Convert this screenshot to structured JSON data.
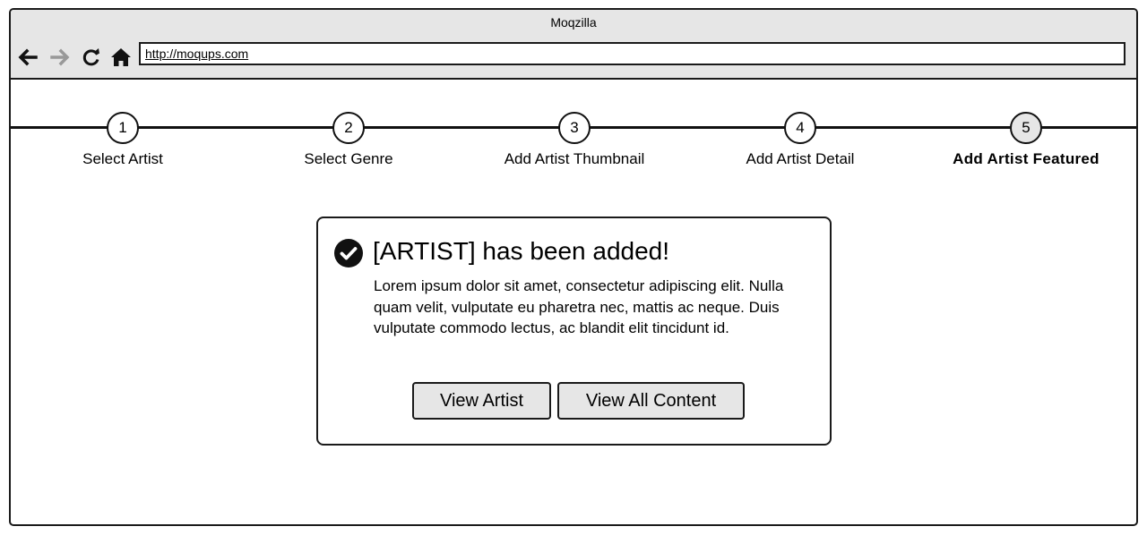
{
  "browser": {
    "title": "Moqzilla",
    "url": "http://moqups.com",
    "nav_icons": [
      "back-arrow-icon",
      "forward-arrow-icon",
      "refresh-icon",
      "home-icon"
    ]
  },
  "stepper": {
    "steps": [
      {
        "number": "1",
        "label": "Select Artist"
      },
      {
        "number": "2",
        "label": "Select Genre"
      },
      {
        "number": "3",
        "label": "Add Artist Thumbnail"
      },
      {
        "number": "4",
        "label": "Add Artist Detail"
      },
      {
        "number": "5",
        "label": "Add Artist Featured"
      }
    ],
    "active_step": 5
  },
  "dialog": {
    "icon": "check-circle-icon",
    "title": "[ARTIST] has been added!",
    "body": "Lorem ipsum dolor sit amet, consectetur adipiscing elit. Nulla quam velit, vulputate eu pharetra nec, mattis ac neque. Duis vulputate commodo lectus, ac blandit elit tincidunt id.",
    "buttons": {
      "view_artist": "View Artist",
      "view_all_content": "View All Content"
    }
  },
  "colors": {
    "chrome_background": "#e6e6e6",
    "border": "#1a1a1a",
    "disabled_nav": "#999999"
  }
}
